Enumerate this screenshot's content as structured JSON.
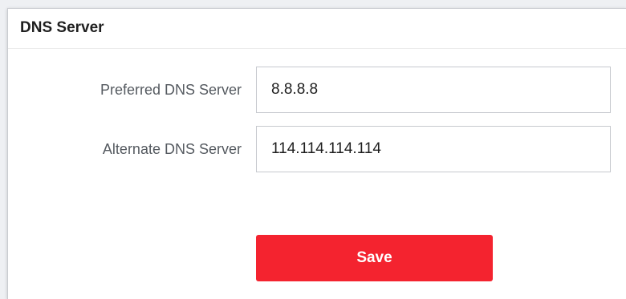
{
  "section": {
    "title": "DNS Server"
  },
  "form": {
    "preferred": {
      "label": "Preferred DNS Server",
      "value": "8.8.8.8"
    },
    "alternate": {
      "label": "Alternate DNS Server",
      "value": "114.114.114.114"
    },
    "save_label": "Save"
  },
  "colors": {
    "accent": "#f4232f"
  }
}
